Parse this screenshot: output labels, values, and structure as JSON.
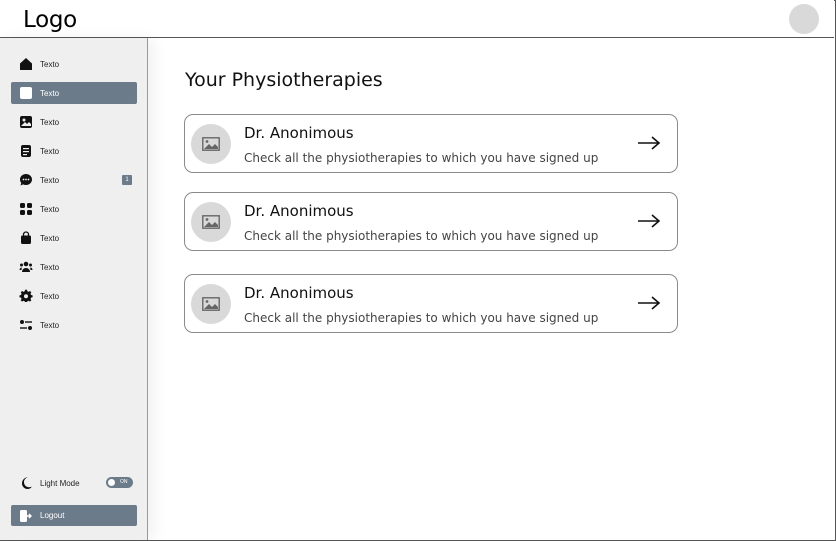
{
  "header": {
    "logo": "Logo"
  },
  "sidebar": {
    "items": [
      {
        "label": "Texto",
        "icon": "home-icon",
        "active": false
      },
      {
        "label": "Texto",
        "icon": "edit-icon",
        "active": true
      },
      {
        "label": "Texto",
        "icon": "image-icon",
        "active": false
      },
      {
        "label": "Texto",
        "icon": "document-icon",
        "active": false
      },
      {
        "label": "Texto",
        "icon": "chat-icon",
        "active": false,
        "badge": "1"
      },
      {
        "label": "Texto",
        "icon": "grid-icon",
        "active": false
      },
      {
        "label": "Texto",
        "icon": "bag-icon",
        "active": false
      },
      {
        "label": "Texto",
        "icon": "users-icon",
        "active": false
      },
      {
        "label": "Texto",
        "icon": "gear-icon",
        "active": false
      },
      {
        "label": "Texto",
        "icon": "sliders-icon",
        "active": false
      }
    ],
    "light_mode": {
      "label": "Light Mode",
      "toggle_text": "ON",
      "icon": "moon-icon"
    },
    "logout": {
      "label": "Logout",
      "icon": "logout-icon"
    }
  },
  "main": {
    "title": "Your Physiotherapies",
    "cards": [
      {
        "name": "Dr. Anonimous",
        "description": "Check all the physiotherapies to which you have signed up"
      },
      {
        "name": "Dr. Anonimous",
        "description": "Check all the physiotherapies to which you have signed up"
      },
      {
        "name": "Dr. Anonimous",
        "description": "Check all the physiotherapies to which you have signed up"
      }
    ]
  },
  "colors": {
    "accent": "#6c7b8a",
    "sidebar_bg": "#efefef",
    "placeholder": "#d9d9d9"
  }
}
